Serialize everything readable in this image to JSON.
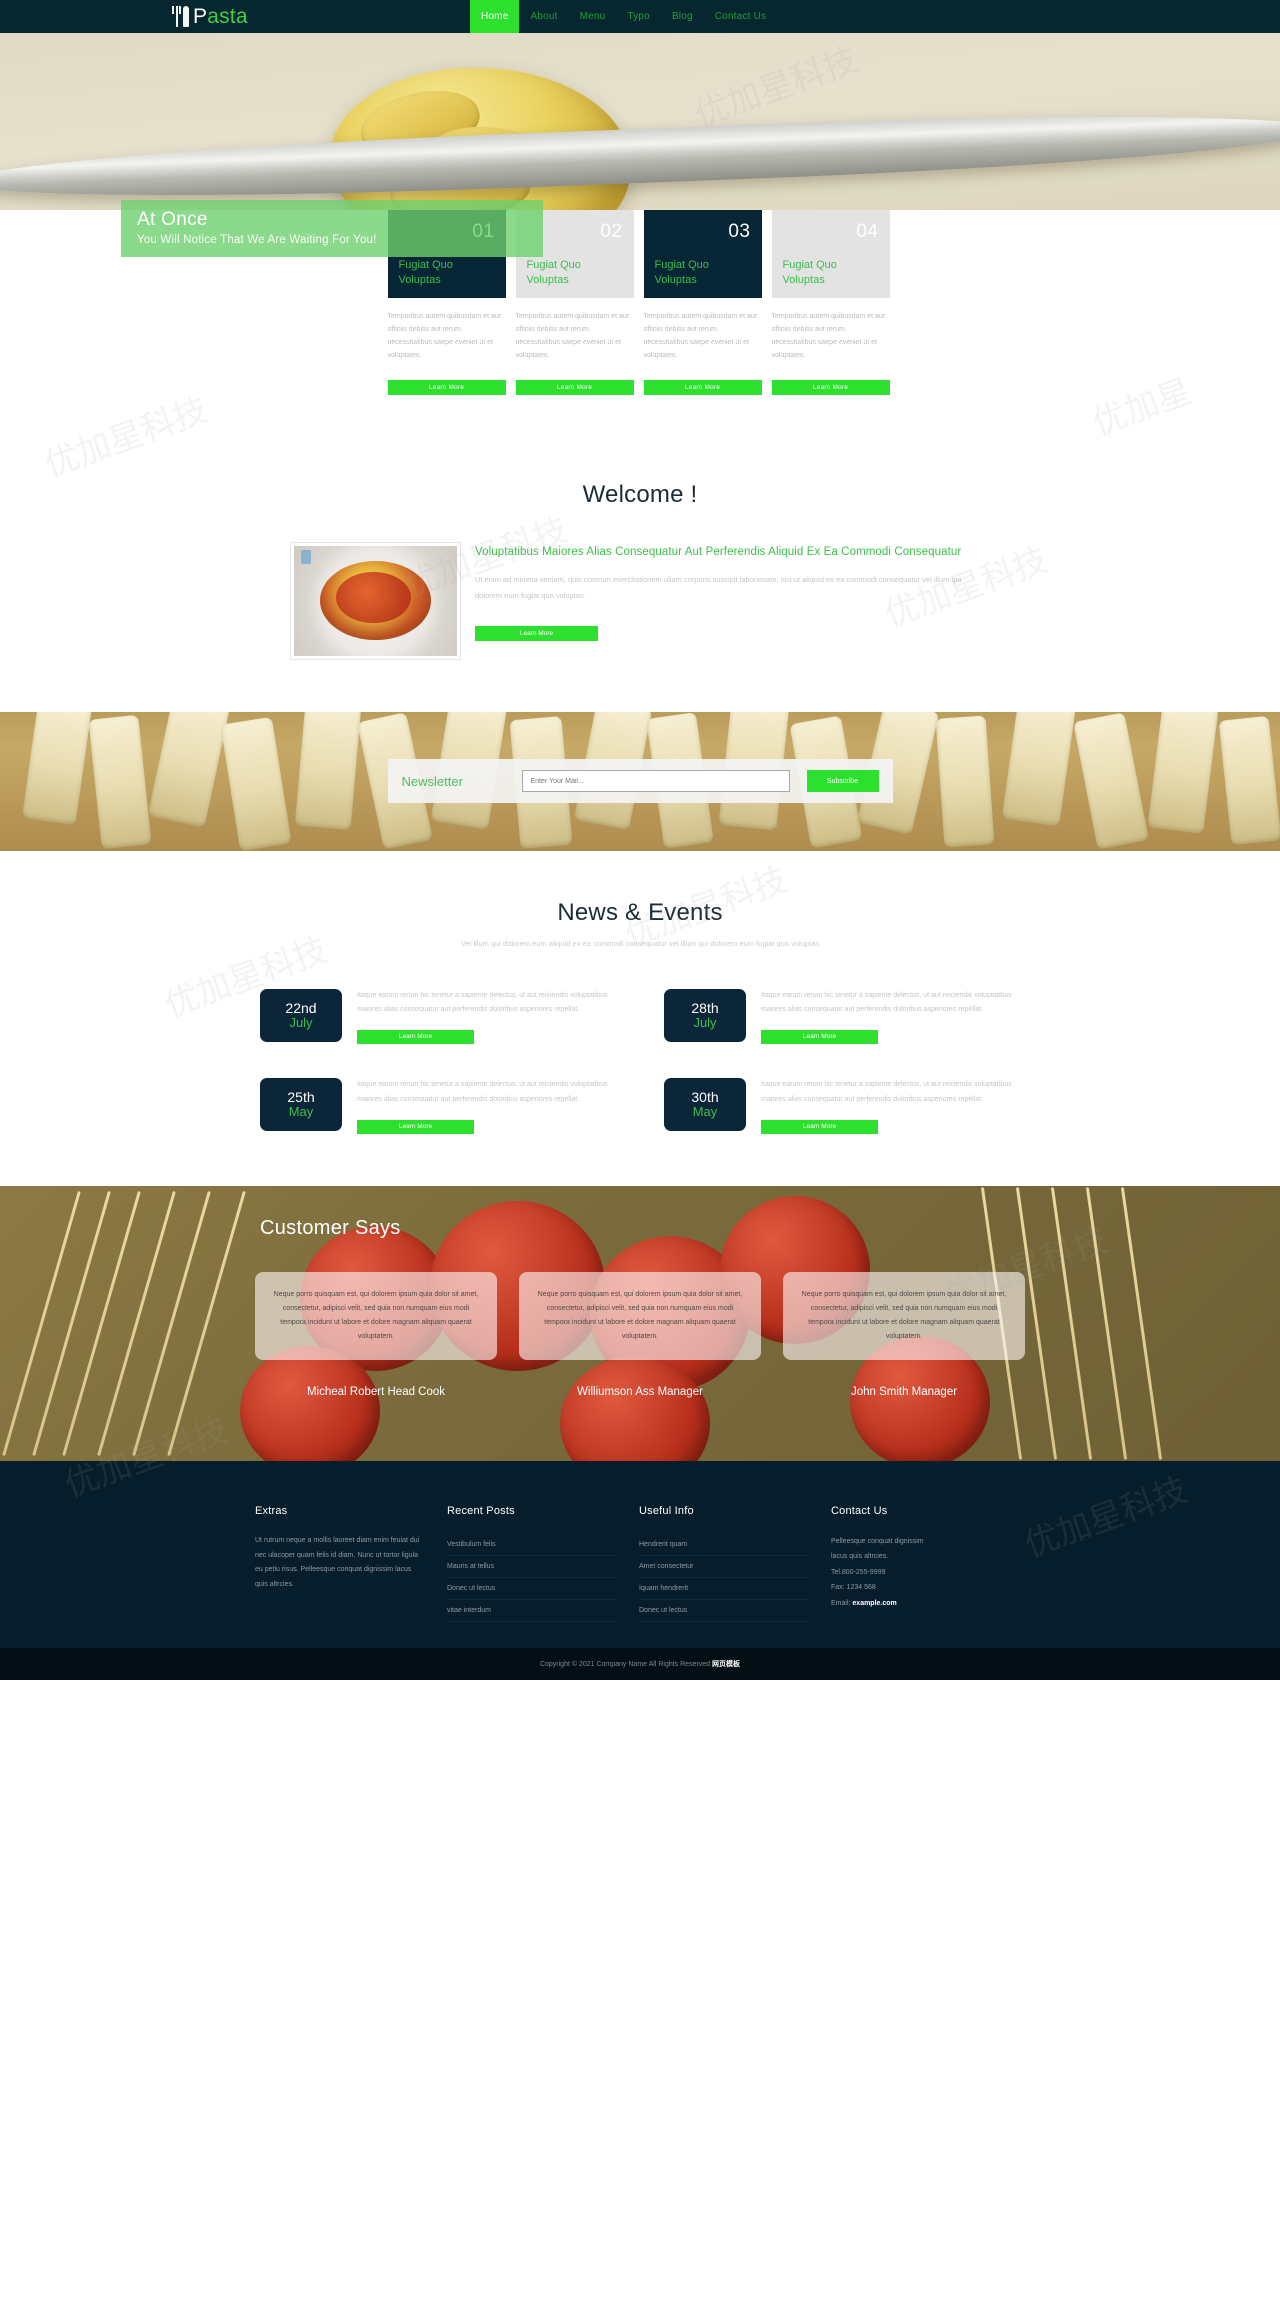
{
  "header": {
    "logo_text": "Pasta",
    "logo_first_letter": "P",
    "nav": [
      {
        "label": "Home",
        "active": true
      },
      {
        "label": "About",
        "active": false
      },
      {
        "label": "Menu",
        "active": false
      },
      {
        "label": "Typo",
        "active": false
      },
      {
        "label": "Blog",
        "active": false
      },
      {
        "label": "Contact Us",
        "active": false
      }
    ]
  },
  "hero": {
    "banner_title": "At Once",
    "banner_subtitle": "You Will Notice That We Are Waiting For You!"
  },
  "services": {
    "items": [
      {
        "number": "01",
        "title": "Fugiat Quo Voluptas",
        "text": "Temporibus autem quibusdam et aut officiis debitis aut rerum necessitatibus saepe eveniet ut et voluptates.",
        "button": "Learn More",
        "theme": "dark"
      },
      {
        "number": "02",
        "title": "Fugiat Quo Voluptas",
        "text": "Temporibus autem quibusdam et aut officiis debitis aut rerum necessitatibus saepe eveniet ut et voluptates.",
        "button": "Learn More",
        "theme": "light"
      },
      {
        "number": "03",
        "title": "Fugiat Quo Voluptas",
        "text": "Temporibus autem quibusdam et aut officiis debitis aut rerum necessitatibus saepe eveniet ut et voluptates.",
        "button": "Learn More",
        "theme": "dark"
      },
      {
        "number": "04",
        "title": "Fugiat Quo Voluptas",
        "text": "Temporibus autem quibusdam et aut officiis debitis aut rerum necessitatibus saepe eveniet ut et voluptates.",
        "button": "Learn More",
        "theme": "light"
      }
    ]
  },
  "welcome": {
    "heading": "Welcome !",
    "title": "Voluptatibus Maiores Alias Consequatur Aut Perferendis Aliquid Ex Ea Commodi Consequatur",
    "text": "Ut enim ad minima veniam, quis nostrum exercitationem ullam corporis suscipit laboriosam, nisi ut aliquid ex ea commodi consequatur vel illum qui dolorem eum fugiat quo voluptas.",
    "button": "Learn More"
  },
  "newsletter": {
    "title": "Newsletter",
    "placeholder": "Enter Your Mail...",
    "value": "",
    "button": "Subscribe"
  },
  "news": {
    "heading": "News & Events",
    "subtitle": "Vel illum qui dolorem eum aliquid ex ea commodi consequatur vel illum qui dolorem eum fugiat quo voluptas",
    "items": [
      {
        "day": "22nd",
        "month": "July",
        "text": "Itaque earum rerum hic tenetur a sapiente delectus, ut aut reiciendis voluptatibus maiores alias consequatur aut perferendis doloribus asperiores repellat.",
        "button": "Learn More"
      },
      {
        "day": "28th",
        "month": "July",
        "text": "Itaque earum rerum hic tenetur a sapiente delectus, ut aut reiciendis voluptatibus maiores alias consequatur aut perferendis doloribus asperiores repellat.",
        "button": "Learn More"
      },
      {
        "day": "25th",
        "month": "May",
        "text": "Itaque earum rerum hic tenetur a sapiente delectus, ut aut reiciendis voluptatibus maiores alias consequatur aut perferendis doloribus asperiores repellat.",
        "button": "Learn More"
      },
      {
        "day": "30th",
        "month": "May",
        "text": "Itaque earum rerum hic tenetur a sapiente delectus, ut aut reiciendis voluptatibus maiores alias consequatur aut perferendis doloribus asperiores repellat.",
        "button": "Learn More"
      }
    ]
  },
  "testimonials": {
    "heading": "Customer Says",
    "items": [
      {
        "quote": "Neque porro quisquam est, qui dolorem ipsum quia dolor sit amet, consectetur, adipisci velit, sed quia non numquam eius modi tempora incidunt ut labore et dolore magnam aliquam quaerat voluptatem.",
        "name": "Micheal Robert Head Cook"
      },
      {
        "quote": "Neque porro quisquam est, qui dolorem ipsum quia dolor sit amet, consectetur, adipisci velit, sed quia non numquam eius modi tempora incidunt ut labore et dolore magnam aliquam quaerat voluptatem.",
        "name": "Williumson Ass Manager"
      },
      {
        "quote": "Neque porro quisquam est, qui dolorem ipsum quia dolor sit amet, consectetur, adipisci velit, sed quia non numquam eius modi tempora incidunt ut labore et dolore magnam aliquam quaerat voluptatem.",
        "name": "John Smith Manager"
      }
    ]
  },
  "footer": {
    "extras": {
      "title": "Extras",
      "text": "Ut rutrum neque a mollis laoreet diam enim feuiat dui nec ulacoper quam felis id diam. Nunc ut tortor ligula eu petiu risus. Pelleesque conquat dignissim lacus quis altrcies."
    },
    "recent_posts": {
      "title": "Recent Posts",
      "items": [
        "Vestibulum felis",
        "Mauris at tellus",
        "Donec ut lectus",
        "vitae interdum"
      ]
    },
    "useful_info": {
      "title": "Useful Info",
      "items": [
        "Hendrerit quam",
        "Amet consectetur",
        "Iquam hendrerit",
        "Donec ut lectus"
      ]
    },
    "contact": {
      "title": "Contact Us",
      "address_line1": "Pelleesque conquat dignissim",
      "address_line2": "lacus quis altrcies.",
      "tel": "Tel.800-255-9999",
      "fax": "Fax: 1234 568",
      "email_label": "Email:",
      "email": "example.com"
    }
  },
  "copyright": {
    "text": "Copyright © 2021 Company Name All Rights Reserved ",
    "highlight": "网页模板"
  },
  "colors": {
    "dark": "#062630",
    "green": "#2ee02e",
    "green_text": "#3bbf4a",
    "card_light": "#e3e3e3"
  }
}
